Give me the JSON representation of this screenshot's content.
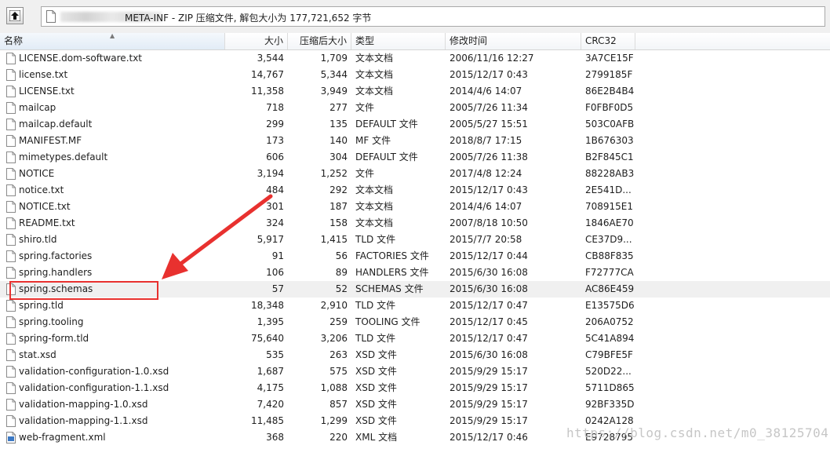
{
  "path": {
    "text": "META-INF - ZIP 压缩文件, 解包大小为 177,721,652 字节"
  },
  "columns": {
    "name": "名称",
    "size": "大小",
    "packed": "压缩后大小",
    "type": "类型",
    "modified": "修改时间",
    "crc": "CRC32"
  },
  "files": [
    {
      "name": "LICENSE.dom-software.txt",
      "size": "3,544",
      "packed": "1,709",
      "type": "文本文档",
      "modified": "2006/11/16 12:27",
      "crc": "3A7CE15F"
    },
    {
      "name": "license.txt",
      "size": "14,767",
      "packed": "5,344",
      "type": "文本文档",
      "modified": "2015/12/17 0:43",
      "crc": "2799185F"
    },
    {
      "name": "LICENSE.txt",
      "size": "11,358",
      "packed": "3,949",
      "type": "文本文档",
      "modified": "2014/4/6 14:07",
      "crc": "86E2B4B4"
    },
    {
      "name": "mailcap",
      "size": "718",
      "packed": "277",
      "type": "文件",
      "modified": "2005/7/26 11:34",
      "crc": "F0FBF0D5"
    },
    {
      "name": "mailcap.default",
      "size": "299",
      "packed": "135",
      "type": "DEFAULT 文件",
      "modified": "2005/5/27 15:51",
      "crc": "503C0AFB"
    },
    {
      "name": "MANIFEST.MF",
      "size": "173",
      "packed": "140",
      "type": "MF 文件",
      "modified": "2018/8/7 17:15",
      "crc": "1B676303"
    },
    {
      "name": "mimetypes.default",
      "size": "606",
      "packed": "304",
      "type": "DEFAULT 文件",
      "modified": "2005/7/26 11:38",
      "crc": "B2F845C1"
    },
    {
      "name": "NOTICE",
      "size": "3,194",
      "packed": "1,252",
      "type": "文件",
      "modified": "2017/4/8 12:24",
      "crc": "88228AB3"
    },
    {
      "name": "notice.txt",
      "size": "484",
      "packed": "292",
      "type": "文本文档",
      "modified": "2015/12/17 0:43",
      "crc": "2E541D..."
    },
    {
      "name": "NOTICE.txt",
      "size": "301",
      "packed": "187",
      "type": "文本文档",
      "modified": "2014/4/6 14:07",
      "crc": "708915E1"
    },
    {
      "name": "README.txt",
      "size": "324",
      "packed": "158",
      "type": "文本文档",
      "modified": "2007/8/18 10:50",
      "crc": "1846AE70"
    },
    {
      "name": "shiro.tld",
      "size": "5,917",
      "packed": "1,415",
      "type": "TLD 文件",
      "modified": "2015/7/7 20:58",
      "crc": "CE37D9..."
    },
    {
      "name": "spring.factories",
      "size": "91",
      "packed": "56",
      "type": "FACTORIES 文件",
      "modified": "2015/12/17 0:44",
      "crc": "CB88F835"
    },
    {
      "name": "spring.handlers",
      "size": "106",
      "packed": "89",
      "type": "HANDLERS 文件",
      "modified": "2015/6/30 16:08",
      "crc": "F72777CA"
    },
    {
      "name": "spring.schemas",
      "size": "57",
      "packed": "52",
      "type": "SCHEMAS 文件",
      "modified": "2015/6/30 16:08",
      "crc": "AC86E459"
    },
    {
      "name": "spring.tld",
      "size": "18,348",
      "packed": "2,910",
      "type": "TLD 文件",
      "modified": "2015/12/17 0:47",
      "crc": "E13575D6"
    },
    {
      "name": "spring.tooling",
      "size": "1,395",
      "packed": "259",
      "type": "TOOLING 文件",
      "modified": "2015/12/17 0:45",
      "crc": "206A0752"
    },
    {
      "name": "spring-form.tld",
      "size": "75,640",
      "packed": "3,206",
      "type": "TLD 文件",
      "modified": "2015/12/17 0:47",
      "crc": "5C41A894"
    },
    {
      "name": "stat.xsd",
      "size": "535",
      "packed": "263",
      "type": "XSD 文件",
      "modified": "2015/6/30 16:08",
      "crc": "C79BFE5F"
    },
    {
      "name": "validation-configuration-1.0.xsd",
      "size": "1,687",
      "packed": "575",
      "type": "XSD 文件",
      "modified": "2015/9/29 15:17",
      "crc": "520D22..."
    },
    {
      "name": "validation-configuration-1.1.xsd",
      "size": "4,175",
      "packed": "1,088",
      "type": "XSD 文件",
      "modified": "2015/9/29 15:17",
      "crc": "5711D865"
    },
    {
      "name": "validation-mapping-1.0.xsd",
      "size": "7,420",
      "packed": "857",
      "type": "XSD 文件",
      "modified": "2015/9/29 15:17",
      "crc": "92BF335D"
    },
    {
      "name": "validation-mapping-1.1.xsd",
      "size": "11,485",
      "packed": "1,299",
      "type": "XSD 文件",
      "modified": "2015/9/29 15:17",
      "crc": "0242A128"
    },
    {
      "name": "web-fragment.xml",
      "size": "368",
      "packed": "220",
      "type": "XML 文档",
      "modified": "2015/12/17 0:46",
      "crc": "E9728795"
    }
  ],
  "watermark": "https://blog.csdn.net/m0_38125704",
  "colors": {
    "highlight_border": "#e8312f",
    "selected_row": "#f0f0f0",
    "header_bg": "#f3f5f8"
  },
  "icons": {
    "up": "up-folder-icon",
    "archive": "zip-archive-icon",
    "file": "document-icon"
  }
}
